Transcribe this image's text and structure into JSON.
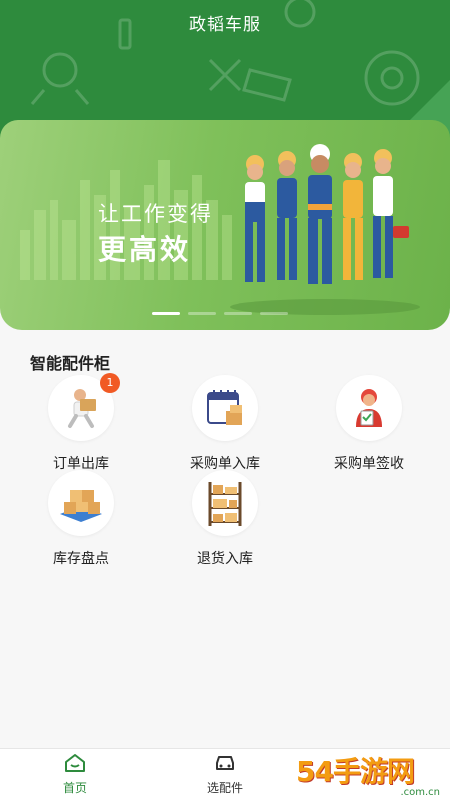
{
  "header": {
    "title": "政韬车服"
  },
  "banner": {
    "line1": "让工作变得",
    "line2": "更高效",
    "slides": [
      true,
      false,
      false,
      false
    ]
  },
  "section": {
    "title": "智能配件柜"
  },
  "tiles": [
    {
      "label": "订单出库",
      "badge": "1",
      "icon": "courier-delivery-icon"
    },
    {
      "label": "采购单入库",
      "icon": "calendar-boxes-icon"
    },
    {
      "label": "采购单签收",
      "icon": "worker-checklist-icon"
    },
    {
      "label": "库存盘点",
      "icon": "box-pallet-icon"
    },
    {
      "label": "退货入库",
      "icon": "warehouse-shelf-icon"
    }
  ],
  "tabbar": {
    "tabs": [
      {
        "label": "首页",
        "icon": "home-icon",
        "active": true
      },
      {
        "label": "选配件",
        "icon": "car-icon",
        "active": false
      }
    ]
  },
  "watermark": {
    "text": "54手游网",
    "sub": ".com.cn"
  },
  "colors": {
    "primary": "#2e8b3d",
    "banner": "#7fc05a",
    "badge": "#f15a24"
  }
}
